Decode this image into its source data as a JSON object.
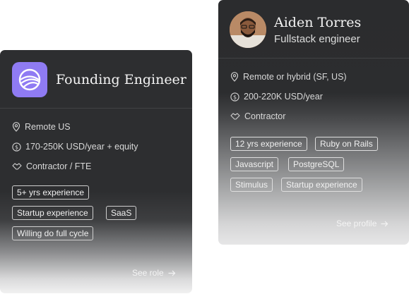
{
  "role_card": {
    "title": "Founding Engineer",
    "meta": {
      "location": "Remote US",
      "salary": "170-250K USD/year + equity",
      "type": "Contractor / FTE"
    },
    "tags": [
      "5+ yrs experience",
      "Startup experience",
      "SaaS",
      "Willing do full cycle"
    ],
    "link": "See role",
    "link_icon": "arrow-right-icon"
  },
  "profile_card": {
    "name": "Aiden Torres",
    "role": "Fullstack engineer",
    "meta": {
      "location": "Remote or hybrid (SF, US)",
      "salary": "200-220K USD/year",
      "type": "Contractor"
    },
    "tags": [
      "12 yrs experience",
      "Ruby on Rails",
      "Javascript",
      "PostgreSQL",
      "Stimulus",
      "Startup experience"
    ],
    "link": "See profile",
    "link_icon": "arrow-right-icon"
  },
  "colors": {
    "card_bg": "#2d2e30",
    "logo_bg": "#8f7bf3",
    "text": "#e8e8e8"
  }
}
